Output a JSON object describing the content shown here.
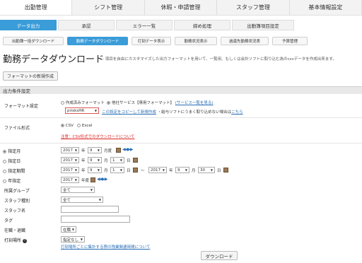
{
  "top_tabs": [
    "出勤管理",
    "シフト管理",
    "休暇・申請管理",
    "スタッフ管理",
    "基本情報設定"
  ],
  "sub_tabs": [
    "データ出力",
    "承認",
    "エラー一覧",
    "締め処理",
    "出勤簿項目設定"
  ],
  "function_buttons": [
    "出勤簿一括ダウンロード",
    "勤務データダウンロード",
    "打刻データ表示",
    "勤務状況表示",
    "過還先勤務状況表",
    "予算管理"
  ],
  "page": {
    "title": "勤務データダウンロード",
    "subtitle": "- 項目を自由にカスタマイズした出力フォーマットを用いて、一覧用、もしくは会計ソフトに取り込む為のcsvデータを作成出来ます。",
    "new_format_button": "フォーマットの新規作成",
    "section_title": "出力条件設定",
    "download_button": "ダウンロード"
  },
  "format": {
    "label": "フォーマット設定",
    "opt_created": "作成済みフォーマット",
    "opt_service": "他社サービス【専用フォーマット】",
    "service_link": "(サービス一覧を見る)",
    "selected": "prisksHR",
    "copy_link": "この設定をコピーして新規作成",
    "note": "・給与ソフトにうまく取り込めない場合は",
    "note_link": "こちら"
  },
  "file_type": {
    "label": "ファイル形式",
    "opt_csv": "CSV",
    "opt_excel": "Excel",
    "warning": "注意：CSV形式でのダウンロードについて"
  },
  "period": {
    "rows": [
      {
        "label": "指定月",
        "year": "2017",
        "month": "9",
        "unit_month": "月度"
      },
      {
        "label": "指定日",
        "year": "2017",
        "month": "9",
        "day": "1"
      },
      {
        "label": "指定期間",
        "year": "2017",
        "month": "9",
        "day": "1",
        "year2": "2017",
        "month2": "9",
        "day2": "30"
      },
      {
        "label": "年指定",
        "year": "2017",
        "unit_year": "年度"
      }
    ],
    "unit_y": "年",
    "unit_m": "月",
    "unit_d": "日",
    "tilde": "〜"
  },
  "filters": {
    "group_label": "所属グループ",
    "group_value": "全て",
    "stafftype_label": "スタッフ種別",
    "stafftype_value": "全て",
    "staffname_label": "スタッフ名",
    "tag_label": "タグ",
    "status_label": "在職・退職",
    "status_value": "在職",
    "punch_label": "打刻場所",
    "punch_value": "指定なし",
    "punch_link": "打刻場所ごとに集計する際の残業関連時間について"
  }
}
